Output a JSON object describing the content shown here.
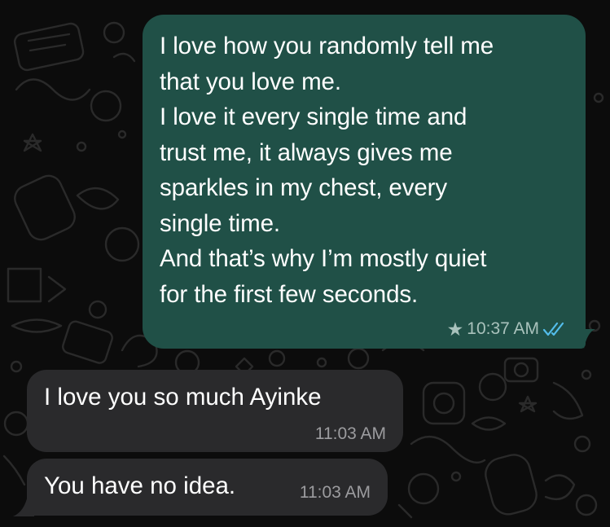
{
  "colors": {
    "background": "#0c0c0c",
    "outgoing_bubble": "#205047",
    "incoming_bubble": "#2a2a2c",
    "read_ticks": "#53bdeb"
  },
  "messages": [
    {
      "direction": "outgoing",
      "text": "I love how you randomly tell me\nthat you love me.\nI love it every single time and\ntrust me, it always gives me\nsparkles in my chest, every\nsingle time.\nAnd that’s why I’m mostly quiet\nfor the first few seconds.",
      "starred": true,
      "star_icon": "star-icon",
      "time": "10:37 AM",
      "status": "read",
      "status_icon": "double-check-icon"
    },
    {
      "direction": "incoming",
      "text": "I love you so much Ayinke",
      "time": "11:03 AM"
    },
    {
      "direction": "incoming",
      "text": "You have no idea.",
      "time": "11:03 AM"
    }
  ]
}
